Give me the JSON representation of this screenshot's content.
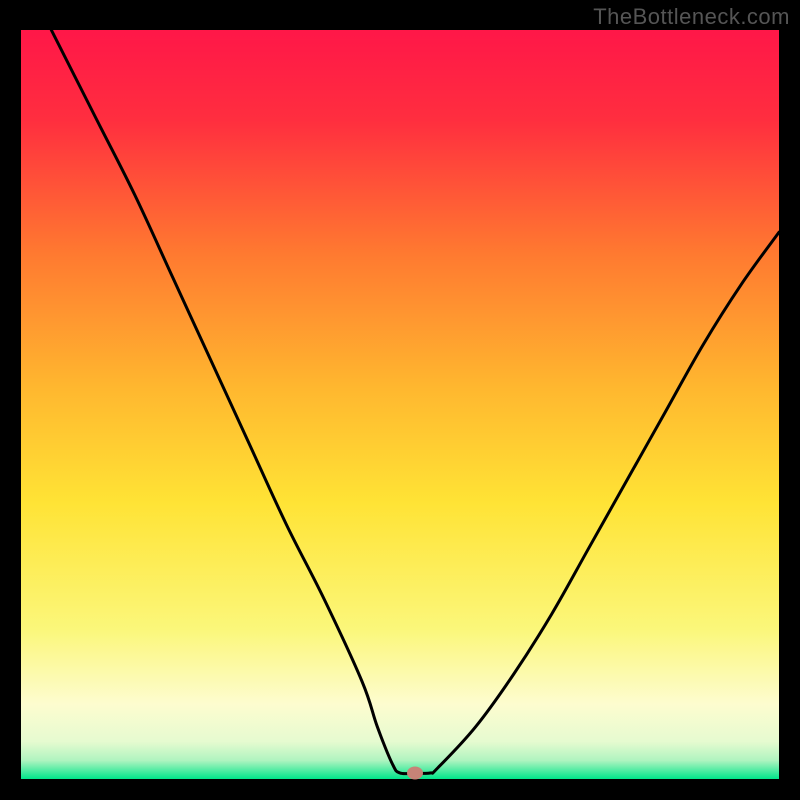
{
  "watermark": "TheBottleneck.com",
  "colors": {
    "bg": "#000000",
    "gradient_top": "#ff1748",
    "gradient_mid_upper": "#ff8a2a",
    "gradient_mid": "#ffe335",
    "gradient_pale": "#fdfccf",
    "gradient_bottom": "#00e58a",
    "curve": "#000000",
    "marker": "#c78377",
    "watermark_text": "#555555"
  },
  "chart_data": {
    "type": "line",
    "title": "",
    "xlabel": "",
    "ylabel": "",
    "xlim": [
      0,
      100
    ],
    "ylim": [
      0,
      100
    ],
    "grid": false,
    "legend": false,
    "series": [
      {
        "name": "bottleneck-curve",
        "x": [
          4,
          10,
          15,
          20,
          25,
          30,
          35,
          40,
          45,
          47,
          49,
          50,
          52,
          54,
          55,
          60,
          65,
          70,
          75,
          80,
          85,
          90,
          95,
          100
        ],
        "y": [
          100,
          88,
          78,
          67,
          56,
          45,
          34,
          24,
          13,
          7,
          2,
          0.8,
          0.8,
          0.8,
          1.5,
          7,
          14,
          22,
          31,
          40,
          49,
          58,
          66,
          73
        ]
      }
    ],
    "marker": {
      "x": 52,
      "y": 0.8,
      "name": "optimal-point"
    },
    "axes_visible": false
  }
}
